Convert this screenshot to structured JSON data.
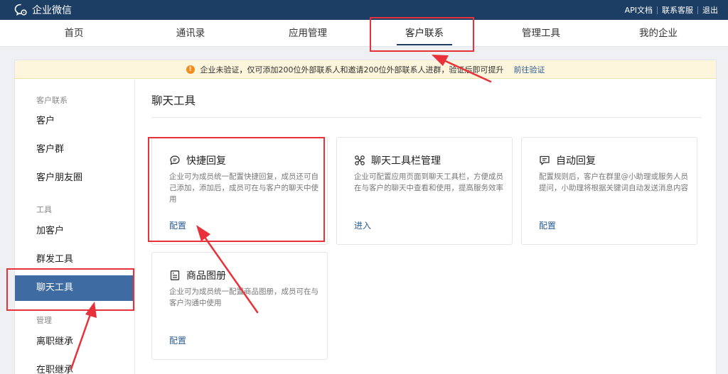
{
  "topbar": {
    "logo_text": "企业微信",
    "links": [
      "API文档",
      "联系客服",
      "退出"
    ]
  },
  "nav": {
    "items": [
      "首页",
      "通讯录",
      "应用管理",
      "客户联系",
      "管理工具",
      "我的企业"
    ],
    "active": "客户联系"
  },
  "notice": {
    "text": "企业未验证，仅可添加200位外部联系人和邀请200位外部联系人进群，验证后即可提升",
    "link": "前往验证"
  },
  "sidebar": {
    "groups": [
      "客户联系",
      "工具",
      "管理"
    ],
    "items": [
      "客户",
      "客户群",
      "客户朋友圈",
      "加客户",
      "群发工具",
      "聊天工具",
      "离职继承",
      "在职继承"
    ],
    "active": "聊天工具"
  },
  "main": {
    "title": "聊天工具",
    "cards": [
      {
        "title": "快捷回复",
        "icon": "chat-bubble-icon",
        "desc": "企业可为成员统一配置快捷回复，成员还可自己添加，添加后，成员可在与客户的聊天中使用",
        "action": "配置"
      },
      {
        "title": "聊天工具栏管理",
        "icon": "toolbar-icon",
        "desc": "企业可配置应用页面到聊天工具栏，方便成员在与客户的聊天中查看和使用，提高服务效率",
        "action": "进入"
      },
      {
        "title": "自动回复",
        "icon": "auto-reply-icon",
        "desc": "配置规则后，客户在群里@小助理或服务人员提问，小助理将根据关键词自动发送消息内容",
        "action": "配置"
      },
      {
        "title": "商品图册",
        "icon": "catalog-icon",
        "desc": "企业可为成员统一配置商品图册，成员可在与客户沟通中使用",
        "action": "配置"
      }
    ]
  },
  "colors": {
    "topbar": "#1c3d64",
    "accent": "#3f6ba3",
    "link": "#2a5c93",
    "highlight": "#e8313a",
    "notice_bg": "#fdf6dc",
    "warn": "#f08d1e"
  }
}
